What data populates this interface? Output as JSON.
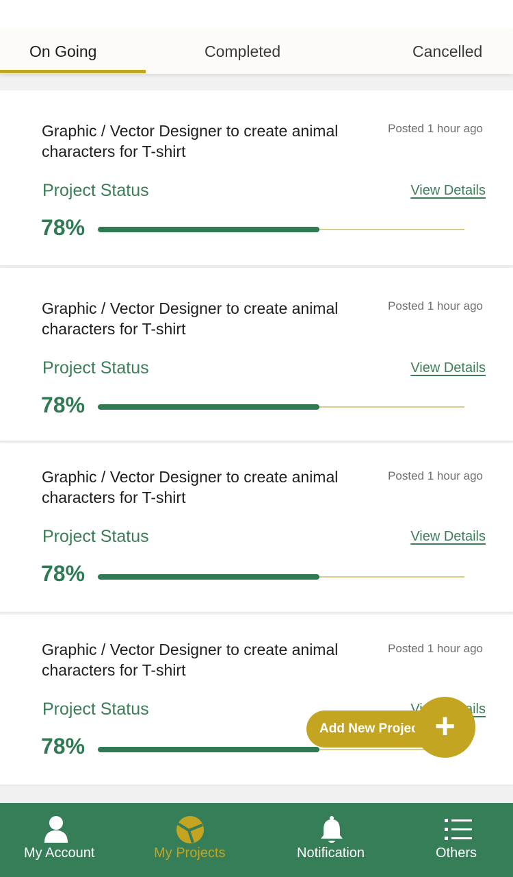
{
  "tabs": [
    {
      "label": "On Going",
      "active": true
    },
    {
      "label": "Completed",
      "active": false
    },
    {
      "label": "Cancelled",
      "active": false
    }
  ],
  "projects": [
    {
      "title": "Graphic / Vector Designer to create animal characters for T-shirt",
      "posted": "Posted 1 hour ago",
      "status_label": "Project Status",
      "link_label": "View Details",
      "progress_text": "78%",
      "progress": 0.78
    },
    {
      "title": "Graphic / Vector Designer to create animal characters for T-shirt",
      "posted": "Posted 1 hour ago",
      "status_label": "Project Status",
      "link_label": "View Details",
      "progress_text": "78%",
      "progress": 0.78
    },
    {
      "title": "Graphic / Vector Designer to create animal characters for T-shirt",
      "posted": "Posted 1 hour ago",
      "status_label": "Project Status",
      "link_label": "View Details",
      "progress_text": "78%",
      "progress": 0.78
    },
    {
      "title": "Graphic / Vector Designer to create animal characters for T-shirt",
      "posted": "Posted 1 hour ago",
      "status_label": "Project Status",
      "link_label": "View Details",
      "progress_text": "78%",
      "progress": 0.78
    }
  ],
  "fab": {
    "label": "Add New Project",
    "icon": "plus-icon",
    "symbol": "+"
  },
  "bottom_nav": [
    {
      "label": "My Account",
      "icon": "user-icon",
      "active": false
    },
    {
      "label": "My Projects",
      "icon": "projects-icon",
      "active": true
    },
    {
      "label": "Notification",
      "icon": "bell-icon",
      "active": false
    },
    {
      "label": "Others",
      "icon": "list-icon",
      "active": false
    }
  ],
  "colors": {
    "primary_green": "#357e58",
    "accent_gold": "#c4a522",
    "progress_track": "#d8cc8a",
    "background": "#f1f1f1"
  }
}
